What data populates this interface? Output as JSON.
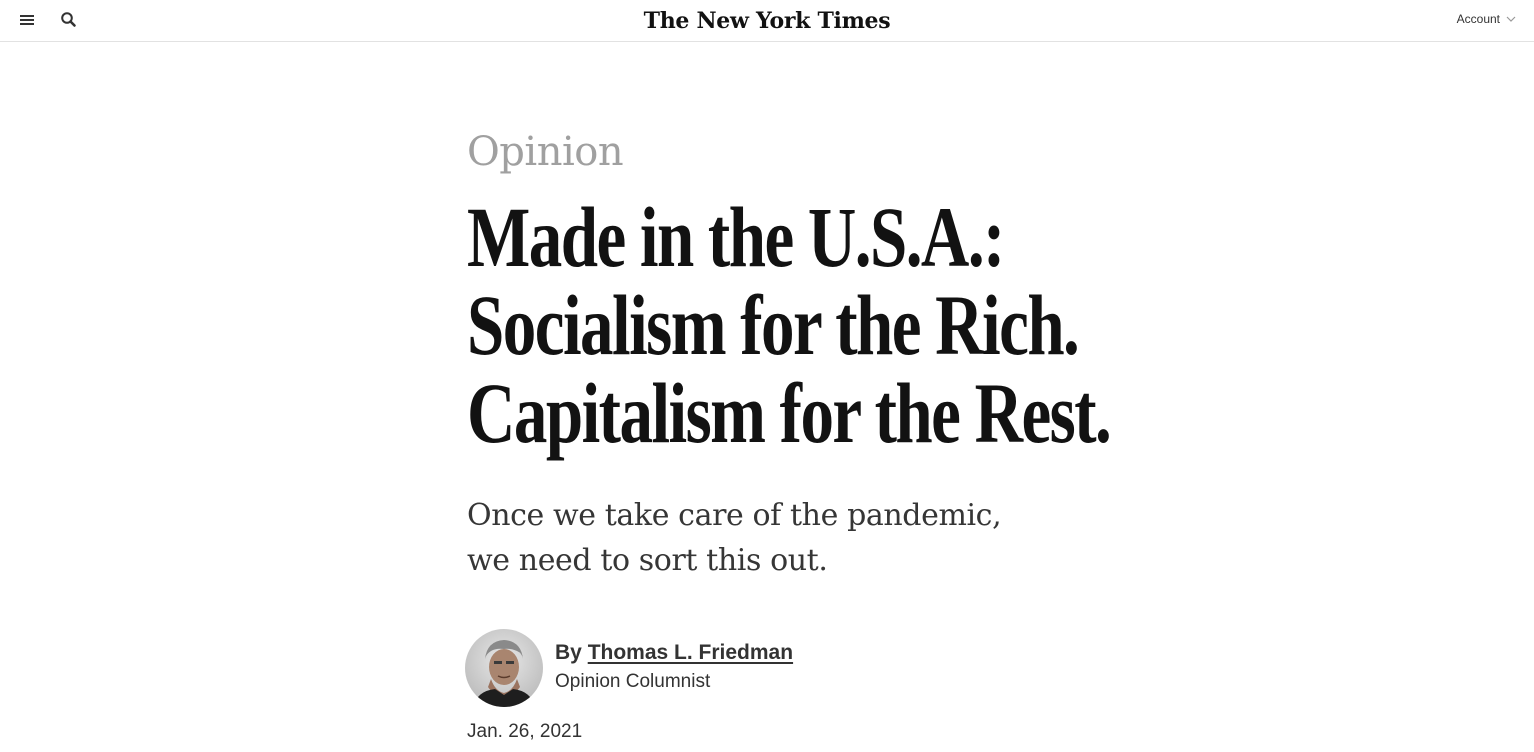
{
  "header": {
    "logo_text": "The New York Times",
    "account_label": "Account",
    "icons": {
      "menu": "hamburger-menu-icon",
      "search": "search-icon",
      "account_chevron": "chevron-down-icon"
    }
  },
  "article": {
    "section": "Opinion",
    "headline_lines": [
      "Made in the U.S.A.:",
      "Socialism for the Rich.",
      "Capitalism for the Rest."
    ],
    "summary": "Once we take care of the pandemic, we need to sort this out.",
    "byline_prefix": "By",
    "author": "Thomas L. Friedman",
    "author_role": "Opinion Columnist",
    "date": "Jan. 26, 2021"
  },
  "colors": {
    "section_gray": "#a0a0a0",
    "text_dark": "#121212",
    "divider": "#e2e2e2"
  }
}
